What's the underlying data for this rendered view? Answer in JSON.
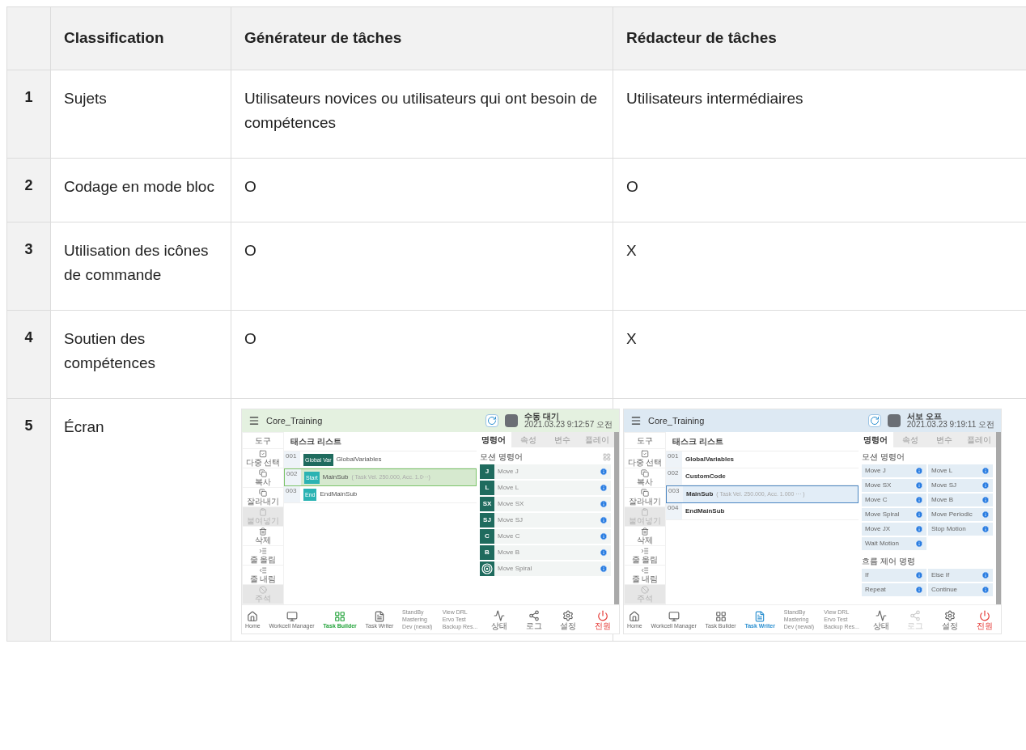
{
  "table": {
    "columns": [
      "",
      "Classification",
      "Générateur de tâches",
      "Rédacteur de tâches"
    ],
    "rows": [
      {
        "num": "1",
        "label": "Sujets",
        "cells": [
          {
            "kind": "text",
            "text": "Utilisateurs novices ou utilisateurs qui ont besoin de compétences"
          },
          {
            "kind": "text",
            "text": "Utilisateurs intermédiaires"
          }
        ]
      },
      {
        "num": "2",
        "label": "Codage en mode bloc",
        "cells": [
          {
            "kind": "text",
            "text": "O"
          },
          {
            "kind": "text",
            "text": "O"
          }
        ]
      },
      {
        "num": "3",
        "label": "Utilisation des icônes de commande",
        "cells": [
          {
            "kind": "text",
            "text": "O"
          },
          {
            "kind": "text",
            "text": "X"
          }
        ]
      },
      {
        "num": "4",
        "label": "Soutien des compétences",
        "cells": [
          {
            "kind": "text",
            "text": "O"
          },
          {
            "kind": "text",
            "text": "X"
          }
        ]
      },
      {
        "num": "5",
        "label": "Écran",
        "cells": [
          {
            "kind": "screen",
            "screen": {
              "kind": "builder",
              "title": "Core_Training",
              "status": "수동 대기",
              "time": "2021.03.23 9:12:57 오전",
              "toolbar_header": "도구",
              "toolbar": [
                {
                  "label": "다중 선택",
                  "disabled": false
                },
                {
                  "label": "복사",
                  "disabled": false
                },
                {
                  "label": "잘라내기",
                  "disabled": false
                },
                {
                  "label": "붙여넣기",
                  "disabled": true
                },
                {
                  "label": "삭제",
                  "disabled": false
                },
                {
                  "label": "줄 올림",
                  "disabled": false
                },
                {
                  "label": "줄 내림",
                  "disabled": false
                },
                {
                  "label": "주석",
                  "disabled": true
                }
              ],
              "list_header": "태스크 리스트",
              "tasks": [
                {
                  "num": "001",
                  "badge": "Global Var",
                  "color": "#1f6b5e",
                  "name": "GlobalVariables",
                  "selected": false
                },
                {
                  "num": "002",
                  "badge": "Start",
                  "color": "#2bb3b3",
                  "name": "MainSub",
                  "params": "( Task Vel. 250.000, Acc. 1.0···)",
                  "selected": true
                },
                {
                  "num": "003",
                  "badge": "End",
                  "color": "#2bb3b3",
                  "name": "EndMainSub",
                  "selected": false
                }
              ],
              "tabs": [
                {
                  "label": "명령어",
                  "selected": true
                },
                {
                  "label": "속성",
                  "selected": false
                },
                {
                  "label": "변수",
                  "selected": false
                },
                {
                  "label": "플레이",
                  "selected": false
                }
              ],
              "section": "모션 명령어",
              "commands": [
                {
                  "kind": "letter",
                  "glyph": "J",
                  "label": "Move J"
                },
                {
                  "kind": "letter",
                  "glyph": "L",
                  "label": "Move L"
                },
                {
                  "kind": "letter",
                  "glyph": "SX",
                  "label": "Move SX"
                },
                {
                  "kind": "letter",
                  "glyph": "SJ",
                  "label": "Move SJ"
                },
                {
                  "kind": "letter",
                  "glyph": "C",
                  "label": "Move C"
                },
                {
                  "kind": "letter",
                  "glyph": "B",
                  "label": "Move B"
                },
                {
                  "kind": "spiral",
                  "label": "Move Spiral"
                }
              ],
              "nav": [
                {
                  "label": "Home",
                  "selected": false
                },
                {
                  "label": "Workcell Manager",
                  "selected": false
                },
                {
                  "label": "Task Builder",
                  "selected": true
                },
                {
                  "label": "Task Writer",
                  "selected": false
                }
              ],
              "dev": [
                "StandBy",
                "View DRL",
                "Mastering",
                "Ervo Test",
                "Dev (newal)",
                "Backup Res..."
              ],
              "system": [
                {
                  "label": "상태",
                  "disabled": false
                },
                {
                  "label": "로그",
                  "disabled": false
                },
                {
                  "label": "설정",
                  "disabled": false
                },
                {
                  "label": "전원",
                  "disabled": false
                }
              ]
            }
          },
          {
            "kind": "screen",
            "screen": {
              "kind": "writer",
              "title": "Core_Training",
              "status": "서보 오프",
              "time": "2021.03.23 9:19:11 오전",
              "toolbar_header": "도구",
              "toolbar": [
                {
                  "label": "다중 선택",
                  "disabled": false
                },
                {
                  "label": "복사",
                  "disabled": false
                },
                {
                  "label": "잘라내기",
                  "disabled": false
                },
                {
                  "label": "붙여넣기",
                  "disabled": true
                },
                {
                  "label": "삭제",
                  "disabled": false
                },
                {
                  "label": "줄 올림",
                  "disabled": false
                },
                {
                  "label": "줄 내림",
                  "disabled": false
                },
                {
                  "label": "주석",
                  "disabled": true
                }
              ],
              "list_header": "태스크 리스트",
              "tasks": [
                {
                  "num": "001",
                  "name": "GlobalVariables",
                  "selected": false
                },
                {
                  "num": "002",
                  "name": "CustomCode",
                  "selected": false
                },
                {
                  "num": "003",
                  "name": "MainSub",
                  "params": "( Task Vel. 250.000, Acc. 1.000 ··· )",
                  "selected": true
                },
                {
                  "num": "004",
                  "name": "EndMainSub",
                  "selected": false
                }
              ],
              "tabs": [
                {
                  "label": "명령어",
                  "selected": true
                },
                {
                  "label": "속성",
                  "selected": false
                },
                {
                  "label": "변수",
                  "selected": false
                },
                {
                  "label": "플레이",
                  "selected": false
                }
              ],
              "section": "모션 명령어",
              "commands": [
                {
                  "label": "Move J"
                },
                {
                  "label": "Move L"
                },
                {
                  "label": "Move SX"
                },
                {
                  "label": "Move SJ"
                },
                {
                  "label": "Move C"
                },
                {
                  "label": "Move B"
                },
                {
                  "label": "Move Spiral"
                },
                {
                  "label": "Move Periodic"
                },
                {
                  "label": "Move JX"
                },
                {
                  "label": "Stop Motion"
                },
                {
                  "label": "Wait Motion"
                }
              ],
              "section2": "흐름 제어 명령",
              "commands2": [
                {
                  "label": "If"
                },
                {
                  "label": "Else If"
                },
                {
                  "label": "Repeat"
                },
                {
                  "label": "Continue"
                }
              ],
              "nav": [
                {
                  "label": "Home",
                  "selected": false
                },
                {
                  "label": "Workcell Manager",
                  "selected": false
                },
                {
                  "label": "Task Builder",
                  "selected": false
                },
                {
                  "label": "Task Writer",
                  "selected": true
                }
              ],
              "dev": [
                "StandBy",
                "View DRL",
                "Mastering",
                "Ervo Test",
                "Dev (newal)",
                "Backup Res..."
              ],
              "system": [
                {
                  "label": "상태",
                  "disabled": false
                },
                {
                  "label": "로그",
                  "disabled": true
                },
                {
                  "label": "설정",
                  "disabled": false
                },
                {
                  "label": "전원",
                  "disabled": false
                }
              ]
            }
          }
        ]
      }
    ]
  }
}
